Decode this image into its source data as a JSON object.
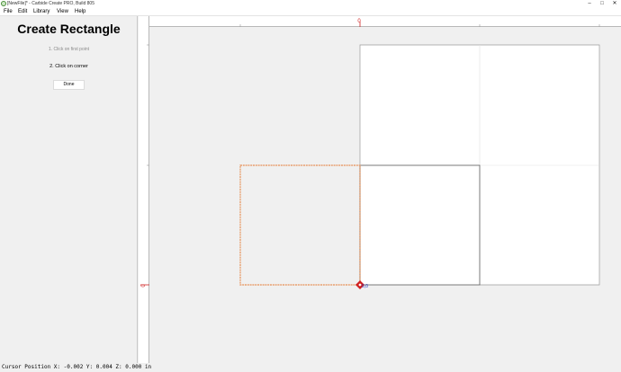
{
  "window": {
    "title": "[NewFile]* - Carbide Create PRO, Build 805",
    "minimize_glyph": "–",
    "maximize_glyph": "□",
    "close_glyph": "✕",
    "icon": "carbide-create-app-icon"
  },
  "menu": {
    "file": "File",
    "edit": "Edit",
    "library": "Library",
    "view": "View",
    "help": "Help"
  },
  "panel": {
    "title": "Create Rectangle",
    "step1": "1. Click on first point",
    "step2": "2. Click on corner",
    "done_label": "Done"
  },
  "rulers": {
    "h_zero_label": "0",
    "v_zero_label": "0"
  },
  "canvas": {
    "origin_label": "0,0",
    "colors": {
      "background": "#f0f0f0",
      "stock": "#ffffff",
      "stock_border": "#9a9a9a",
      "grid": "#e2e2e2",
      "selection": "#e8a070",
      "origin_marker": "#d02020",
      "origin_text": "#2030c0"
    }
  },
  "status": {
    "cursor_position": "Cursor Position X: -0.002 Y: 0.004 Z: 0.000 in"
  }
}
